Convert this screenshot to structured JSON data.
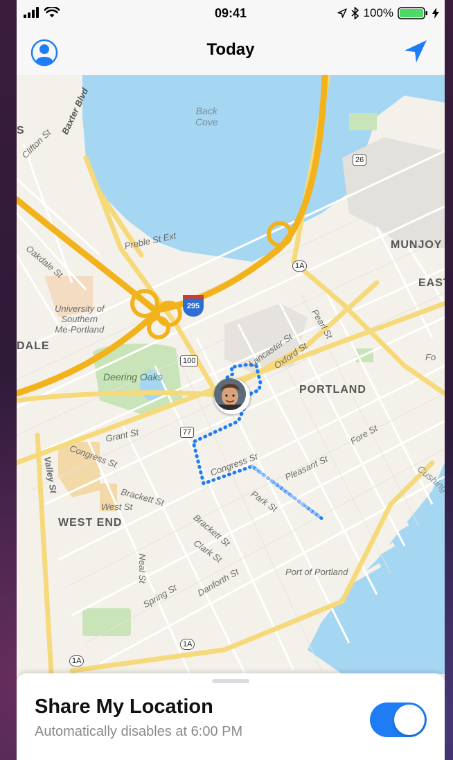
{
  "status_bar": {
    "time": "09:41",
    "battery": "100%",
    "icons": [
      "signal-bars-icon",
      "wifi-icon",
      "location-arrow-icon",
      "bluetooth-icon",
      "battery-icon",
      "charging-bolt-icon"
    ]
  },
  "nav": {
    "title": "Today",
    "left_icon": "profile-icon",
    "right_icon": "location-arrow-icon",
    "accent": "#1e7df5"
  },
  "map": {
    "labels": {
      "back_cove_1": "Back",
      "back_cove_2": "Cove",
      "baxter": "Baxter Blvd",
      "clifton": "Clifton St",
      "preble": "Preble St Ext",
      "oakdale": "Oakdale St",
      "usm_1": "University of",
      "usm_2": "Southern",
      "usm_3": "Me-Portland",
      "dale": "DALE",
      "deering": "Deering Oaks",
      "munjoy": "MUNJOY",
      "east": "EAST",
      "pearl": "Pearl St",
      "oxford": "Oxford St",
      "lancaster": "Lancaster St",
      "portland": "PORTLAND",
      "grant": "Grant St",
      "congress_w": "Congress St",
      "congress_e": "Congress St",
      "fore": "Fore St",
      "valley": "Valley St",
      "brackett_1": "Brackett St",
      "brackett_2": "Brackett St",
      "pleasant": "Pleasant St",
      "park": "Park St",
      "west": "West St",
      "west_end": "WEST END",
      "clark": "Clark St",
      "neal": "Neal St",
      "danforth": "Danforth St",
      "spring": "Spring St",
      "port": "Port of Portland",
      "cushing": "Cushing",
      "s": "S",
      "fo": "Fo"
    },
    "shields": {
      "r26": "26",
      "r1a_a": "1A",
      "i295": "295",
      "r100": "100",
      "r77": "77",
      "r1a_b": "1A",
      "r1a_c": "1A"
    }
  },
  "sheet": {
    "title": "Share My Location",
    "subtitle": "Automatically disables at 6:00 PM",
    "toggle_on": true,
    "toggle_color": "#1e7df5"
  }
}
